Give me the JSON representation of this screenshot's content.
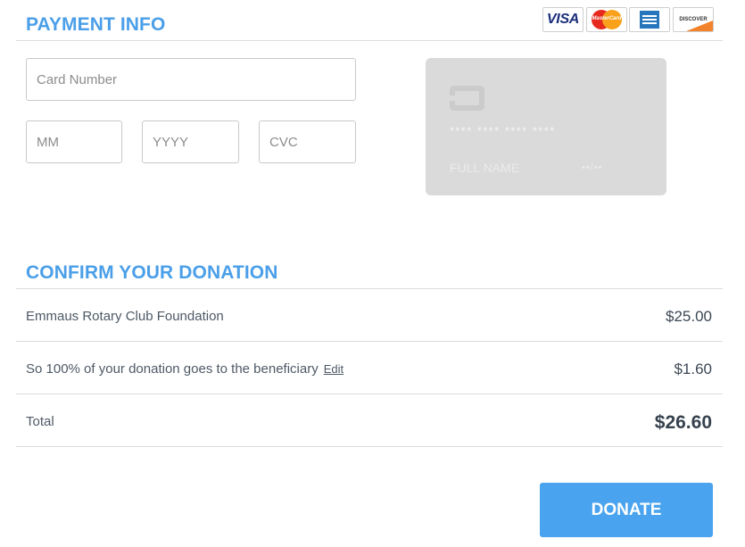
{
  "payment": {
    "title": "PAYMENT INFO",
    "card_logos": {
      "visa": "VISA",
      "mastercard": "MasterCard",
      "amex": "AMEX",
      "discover": "DISCOVER"
    },
    "fields": {
      "card_number_placeholder": "Card Number",
      "month_placeholder": "MM",
      "year_placeholder": "YYYY",
      "cvc_placeholder": "CVC"
    },
    "card_preview": {
      "number": "•••• •••• •••• ••••",
      "name": "FULL NAME",
      "expiry": "••/••"
    }
  },
  "donation": {
    "title": "CONFIRM YOUR DONATION",
    "rows": [
      {
        "label": "Emmaus Rotary Club Foundation",
        "amount": "$25.00"
      },
      {
        "label": "So 100% of your donation goes to the beneficiary",
        "link": "Edit",
        "amount": "$1.60"
      }
    ],
    "total": {
      "label": "Total",
      "amount": "$26.60"
    }
  },
  "actions": {
    "donate_label": "DONATE"
  },
  "colors": {
    "accent": "#4a9fe8",
    "button": "#4aa3ee",
    "card_preview_bg": "#dadada"
  }
}
